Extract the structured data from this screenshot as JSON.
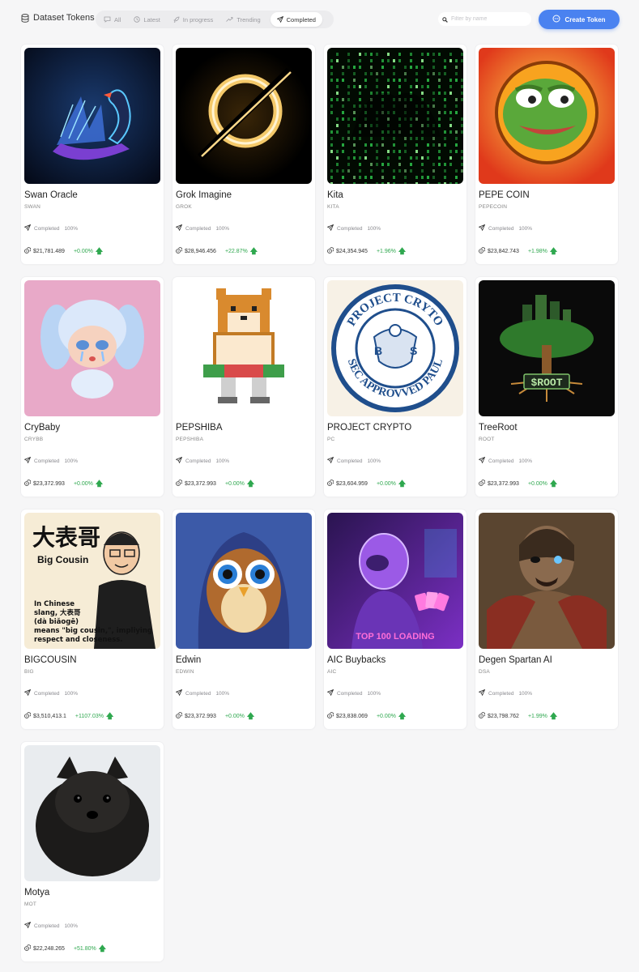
{
  "header": {
    "title": "Dataset Tokens",
    "tabs": [
      {
        "label": "All",
        "icon": "chat-icon"
      },
      {
        "label": "Latest",
        "icon": "clock-icon"
      },
      {
        "label": "In progress",
        "icon": "rocket-icon"
      },
      {
        "label": "Trending",
        "icon": "trending-icon"
      },
      {
        "label": "Completed",
        "icon": "send-icon",
        "active": true
      }
    ],
    "search_placeholder": "Filter by name",
    "create_label": "Create Token",
    "accent_color": "#4a82f0"
  },
  "colors": {
    "positive": "#2fa84f"
  },
  "tokens": [
    {
      "name": "Swan Oracle",
      "ticker": "SWAN",
      "status": "Completed",
      "progress": "100%",
      "price": "$21,781.489",
      "change": "+0.00%",
      "image": "cyber-swan"
    },
    {
      "name": "Grok Imagine",
      "ticker": "GROK",
      "status": "Completed",
      "progress": "100%",
      "price": "$28,946.456",
      "change": "+22.87%",
      "image": "glowing-ring"
    },
    {
      "name": "Kita",
      "ticker": "KITA",
      "status": "Completed",
      "progress": "100%",
      "price": "$24,354.945",
      "change": "+1.96%",
      "image": "green-code-rain"
    },
    {
      "name": "PEPE COIN",
      "ticker": "PEPECOIN",
      "status": "Completed",
      "progress": "100%",
      "price": "$23,842.743",
      "change": "+1.98%",
      "image": "pepe-frog"
    },
    {
      "name": "CryBaby",
      "ticker": "CRYBB",
      "status": "Completed",
      "progress": "100%",
      "price": "$23,372.993",
      "change": "+0.00%",
      "image": "crybaby-figure"
    },
    {
      "name": "PEPSHIBA",
      "ticker": "PEPSHIBA",
      "status": "Completed",
      "progress": "100%",
      "price": "$23,372.993",
      "change": "+0.00%",
      "image": "pixel-shiba"
    },
    {
      "name": "PROJECT CRYPTO",
      "ticker": "PC",
      "status": "Completed",
      "progress": "100%",
      "price": "$23,604.959",
      "change": "+0.00%",
      "image": "sec-seal",
      "seal_top": "PROJECT CRYTO",
      "seal_bottom": "SEC APPROVVED PAUL"
    },
    {
      "name": "TreeRoot",
      "ticker": "ROOT",
      "status": "Completed",
      "progress": "100%",
      "price": "$23,372.993",
      "change": "+0.00%",
      "image": "circuit-tree",
      "sign": "$ROOT"
    },
    {
      "name": "BIGCOUSIN",
      "ticker": "BIG",
      "status": "Completed",
      "progress": "100%",
      "price": "$3,510,413.1",
      "change": "+1107.03%",
      "image": "big-cousin",
      "art_title": "大表哥",
      "art_subtitle": "Big Cousin",
      "art_text": [
        "In Chinese",
        "slang, 大表哥",
        "(dà biǎogē)",
        "means \"big cousin,\", impliying",
        "respect and closeness."
      ]
    },
    {
      "name": "Edwin",
      "ticker": "EDWIN",
      "status": "Completed",
      "progress": "100%",
      "price": "$23,372.993",
      "change": "+0.00%",
      "image": "hooded-owl"
    },
    {
      "name": "AIC Buybacks",
      "ticker": "AIC",
      "status": "Completed",
      "progress": "100%",
      "price": "$23,838.069",
      "change": "+0.00%",
      "image": "purple-robot",
      "banner": "TOP 100 LOADING"
    },
    {
      "name": "Degen Spartan AI",
      "ticker": "DSA",
      "status": "Completed",
      "progress": "100%",
      "price": "$23,798.762",
      "change": "+1.99%",
      "image": "spartan-warrior"
    },
    {
      "name": "Motya",
      "ticker": "MOT",
      "status": "Completed",
      "progress": "100%",
      "price": "$22,248.265",
      "change": "+51.80%",
      "image": "black-pomeranian"
    }
  ]
}
